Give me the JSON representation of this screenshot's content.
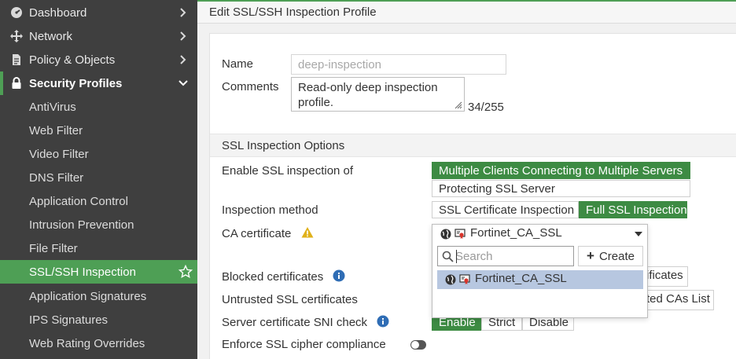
{
  "sidebar": {
    "items": [
      {
        "label": "Dashboard",
        "icon": "dashboard-icon"
      },
      {
        "label": "Network",
        "icon": "network-icon"
      },
      {
        "label": "Policy & Objects",
        "icon": "policy-icon"
      },
      {
        "label": "Security Profiles",
        "icon": "lock-icon"
      }
    ],
    "sub_items": [
      "AntiVirus",
      "Web Filter",
      "Video Filter",
      "DNS Filter",
      "Application Control",
      "Intrusion Prevention",
      "File Filter",
      "SSL/SSH Inspection",
      "Application Signatures",
      "IPS Signatures",
      "Web Rating Overrides"
    ]
  },
  "page": {
    "title": "Edit SSL/SSH Inspection Profile"
  },
  "form": {
    "name_label": "Name",
    "name_value": "deep-inspection",
    "comments_label": "Comments",
    "comments_value": "Read-only deep inspection profile.",
    "comments_counter": "34/255",
    "section_title": "SSL Inspection Options",
    "enable_label": "Enable SSL inspection of",
    "enable_opt1": "Multiple Clients Connecting to Multiple Servers",
    "enable_opt2": "Protecting SSL Server",
    "method_label": "Inspection method",
    "method_opt1": "SSL Certificate Inspection",
    "method_opt2": "Full SSL Inspection",
    "ca_label": "CA certificate",
    "ca_value": "Fortinet_CA_SSL",
    "blocked_label": "Blocked certificates",
    "blocked_behind": "ificates",
    "untrusted_label": "Untrusted SSL certificates",
    "untrusted_behind": "ted CAs List",
    "sni_label": "Server certificate SNI check",
    "sni_opt1": "Enable",
    "sni_opt2": "Strict",
    "sni_opt3": "Disable",
    "cipher_label": "Enforce SSL cipher compliance"
  },
  "dropdown": {
    "search_placeholder": "Search",
    "create_label": "Create",
    "item": "Fortinet_CA_SSL"
  },
  "colors": {
    "accent_green": "#4e9f55",
    "sidebar_bg": "#3f3f3f",
    "selected_item": "#b7c7e0"
  }
}
